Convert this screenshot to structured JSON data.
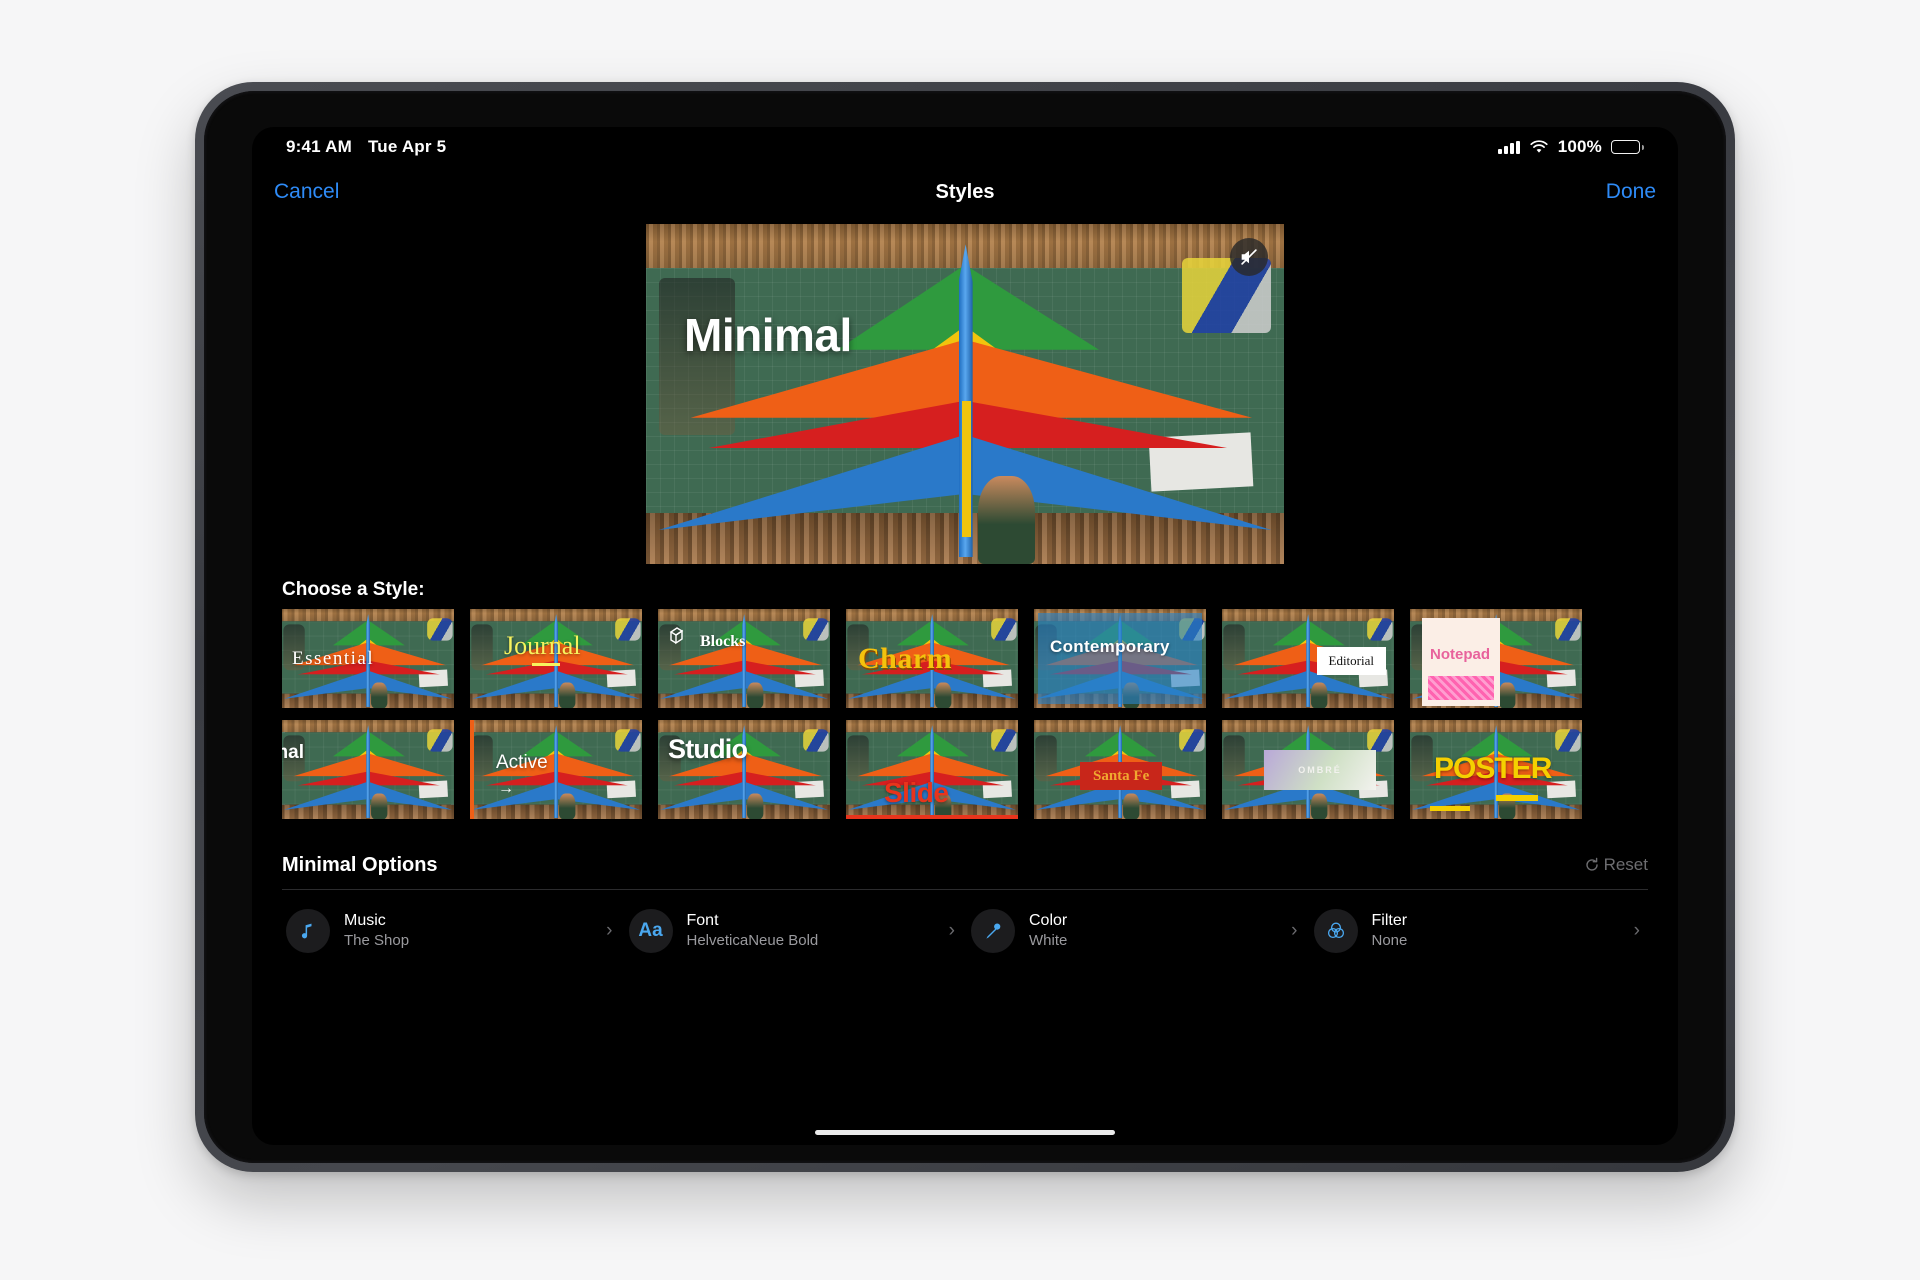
{
  "status_bar": {
    "time": "9:41 AM",
    "date": "Tue Apr 5",
    "battery_percent": "100%",
    "cellular_icon": "cellular-bars-icon",
    "wifi_icon": "wifi-icon",
    "battery_icon": "battery-full-icon"
  },
  "nav": {
    "cancel_label": "Cancel",
    "title": "Styles",
    "done_label": "Done",
    "accent_color": "#2e8bf7"
  },
  "preview": {
    "overlay_title": "Minimal",
    "mute_icon": "mute-speaker-icon"
  },
  "styles_section": {
    "heading": "Choose a Style:",
    "selected_style": "Studio",
    "rows": [
      [
        {
          "name": "Essential",
          "label": "Essential"
        },
        {
          "name": "Journal",
          "label": "Journal"
        },
        {
          "name": "Blocks",
          "label": "Blocks"
        },
        {
          "name": "Charm",
          "label": "Charm"
        },
        {
          "name": "Contemporary",
          "label": "Contemporary"
        },
        {
          "name": "Editorial",
          "label": "Editorial"
        },
        {
          "name": "Notepad",
          "label": "Notepad"
        }
      ],
      [
        {
          "name": "Minimal",
          "label": "imal"
        },
        {
          "name": "Active",
          "label": "Active"
        },
        {
          "name": "Studio",
          "label": "Studio"
        },
        {
          "name": "Slide",
          "label": "Slide"
        },
        {
          "name": "Santa Fe",
          "label": "Santa Fe"
        },
        {
          "name": "Ombre",
          "label": "OMBRÉ"
        },
        {
          "name": "Poster",
          "label": "POSTER"
        }
      ]
    ]
  },
  "options": {
    "title": "Minimal Options",
    "reset_label": "Reset",
    "reset_icon": "reset-circular-arrow-icon",
    "items": [
      {
        "icon": "music-note-icon",
        "title": "Music",
        "value": "The Shop"
      },
      {
        "icon": "font-aa-icon",
        "title": "Font",
        "value": "HelveticaNeue Bold"
      },
      {
        "icon": "eyedropper-icon",
        "title": "Color",
        "value": "White"
      },
      {
        "icon": "filter-circles-icon",
        "title": "Filter",
        "value": "None"
      }
    ],
    "chevron": "›"
  }
}
